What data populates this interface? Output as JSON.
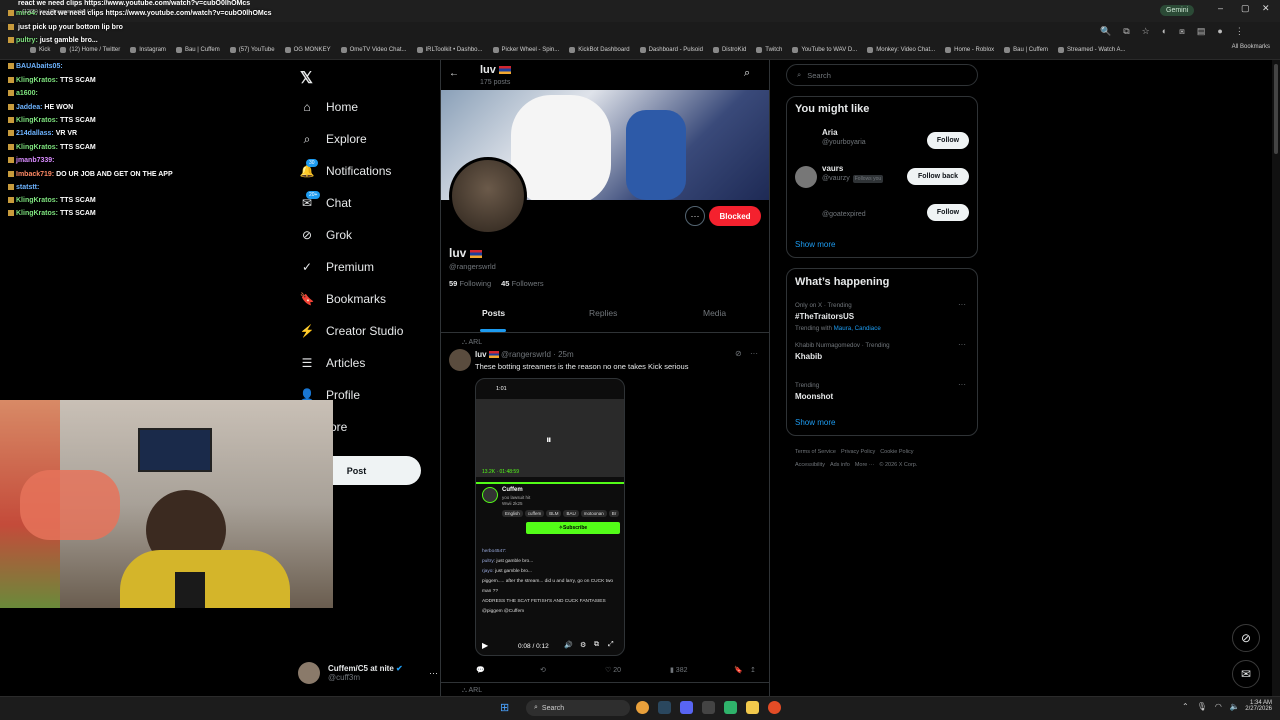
{
  "browser": {
    "tab1": "react we need clips https://www.youtube.com/watch?v=cubO0lhOMcs",
    "tab2": "(1265) luv [@rangerswrld] / X",
    "gemini": "Gemini",
    "all_bookmarks": "All Bookmarks",
    "bookmarks": [
      "Kick",
      "(12) Home / Twitter",
      "Instagram",
      "Bau | Cuffem",
      "(57) YouTube",
      "OG MONKEY",
      "OmeTV Video Chat...",
      "IRLToolkit • Dashbo...",
      "Picker Wheel - Spin...",
      "KickBot Dashboard",
      "Dashboard - Pulsoid",
      "DistroKid",
      "Twitch",
      "YouTube to WAV D...",
      "Monkey: Video Chat...",
      "Home - Roblox",
      "Bau | Cuffem",
      "Streamed - Watch A..."
    ]
  },
  "chat": [
    {
      "user": "miro4:",
      "msg": "react we need clips https://www.youtube.com/watch?v=cubO0lhOMcs"
    },
    {
      "user": "",
      "msg": "just pick up your bottom lip bro"
    },
    {
      "user": "pultry:",
      "msg": "just gamble bro..."
    },
    {
      "user": "BAUAbaits05:",
      "msg": ""
    },
    {
      "user": "KlingKratos:",
      "msg": "TTS SCAM"
    },
    {
      "user": "a1600:",
      "msg": ""
    },
    {
      "user": "Jaddea:",
      "msg": "HE WON"
    },
    {
      "user": "KlingKratos:",
      "msg": "TTS SCAM"
    },
    {
      "user": "214dallass:",
      "msg": "VR VR"
    },
    {
      "user": "KlingKratos:",
      "msg": "TTS SCAM"
    },
    {
      "user": "jmanb7339:",
      "msg": ""
    },
    {
      "user": "Imback719:",
      "msg": "DO UR JOB AND GET ON THE APP"
    },
    {
      "user": "statstt:",
      "msg": ""
    },
    {
      "user": "KlingKratos:",
      "msg": "TTS SCAM"
    },
    {
      "user": "KlingKratos:",
      "msg": "TTS SCAM"
    }
  ],
  "nav": {
    "items": [
      {
        "label": "Home",
        "icon": "home-icon"
      },
      {
        "label": "Explore",
        "icon": "search-icon"
      },
      {
        "label": "Notifications",
        "icon": "bell-icon",
        "badge": "30"
      },
      {
        "label": "Chat",
        "icon": "mail-icon",
        "badge": "20+"
      },
      {
        "label": "Grok",
        "icon": "grok-icon"
      },
      {
        "label": "Premium",
        "icon": "premium-icon"
      },
      {
        "label": "Bookmarks",
        "icon": "bookmark-icon"
      },
      {
        "label": "Creator Studio",
        "icon": "creator-icon"
      },
      {
        "label": "Articles",
        "icon": "articles-icon"
      },
      {
        "label": "Profile",
        "icon": "person-icon"
      },
      {
        "label": "ore",
        "icon": "more-icon"
      }
    ],
    "post_label": "Post",
    "account_name": "Cuffem/C5 at nite",
    "account_handle": "@cuff3m"
  },
  "profile": {
    "header_name": "luv",
    "posts_count": "175 posts",
    "name": "luv",
    "handle": "@rangerswrld",
    "following_count": "59",
    "following_label": "Following",
    "followers_count": "45",
    "followers_label": "Followers",
    "blocked_label": "Blocked",
    "tabs": [
      "Posts",
      "Replies",
      "Media"
    ]
  },
  "post": {
    "context": "ARL",
    "name": "luv",
    "handle": "@rangerswrld",
    "time": "· 25m",
    "text": "These botting streamers is the reason no one takes Kick serious",
    "video_time": "0:08 / 0:12",
    "replies": "",
    "likes": "20",
    "views": "382",
    "next_context": "ARL",
    "video": {
      "status_time": "1:01",
      "viewer_count": "13.2K",
      "uptime": "01:48:59",
      "channel": "Cuffem",
      "channel_sub": "yoo lawsuit hit",
      "channel_sub2": "Wwii 2k25",
      "tags": [
        "English",
        "cuffem",
        "BLM",
        "BAU",
        "motoonan",
        "Br"
      ],
      "subscribe": "Subscribe",
      "chat": [
        {
          "user": "herbo4547:",
          "msg": ""
        },
        {
          "user": "pultry:",
          "msg": "just gamble bro..."
        },
        {
          "user": "rjayo:",
          "msg": "just gamble bro..."
        },
        {
          "user": "",
          "msg": "piggem..... after the stream... did u and larry, go on CUCK two man ??"
        },
        {
          "user": "",
          "msg": "ADDRESS THE SCAT FETISH'S AND CUCK FANTASIES @piggem @Cuffem"
        }
      ]
    }
  },
  "right": {
    "search_placeholder": "Search",
    "you_might_like": "You might like",
    "suggestions": [
      {
        "name": "Aria",
        "handle": "@yourboyaria",
        "button": "Follow",
        "follows_you": ""
      },
      {
        "name": "vaurs",
        "handle": "@vaurzy",
        "button": "Follow back",
        "follows_you": "Follows you"
      },
      {
        "name": "",
        "handle": "@goatexpired",
        "button": "Follow",
        "follows_you": ""
      }
    ],
    "show_more": "Show more",
    "whats_happening": "What’s happening",
    "trends": [
      {
        "context": "Only on X · Trending",
        "title": "#TheTraitorsUS",
        "sub_prefix": "Trending with",
        "sub_links": "Maura, Candiace"
      },
      {
        "context": "Khabib Nurmagomedov · Trending",
        "title": "Khabib",
        "sub_prefix": "",
        "sub_links": ""
      },
      {
        "context": "Trending",
        "title": "Moonshot",
        "sub_prefix": "",
        "sub_links": ""
      }
    ],
    "show_more2": "Show more",
    "footer1": [
      "Terms of Service",
      "Privacy Policy",
      "Cookie Policy"
    ],
    "footer2": [
      "Accessibility",
      "Ads info",
      "More ···",
      "© 2026 X Corp."
    ]
  },
  "taskbar": {
    "search": "Search",
    "time": "1:34 AM",
    "date": "2/27/2026"
  },
  "colors": {
    "accent": "#1d9bf0",
    "blocked": "#f4212e",
    "kick_green": "#53fc18"
  }
}
